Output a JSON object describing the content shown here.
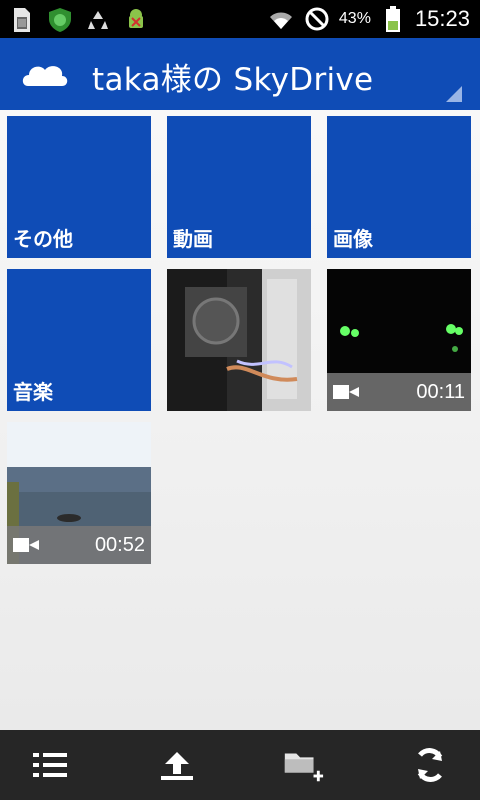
{
  "status_bar": {
    "battery_percent": "43%",
    "time": "15:23",
    "left_icons": [
      "sim-card-icon",
      "shield-lion-icon",
      "recycle-icon",
      "android-bug-icon"
    ],
    "right_icons": [
      "wifi-icon",
      "no-signal-icon",
      "battery-icon"
    ]
  },
  "app_bar": {
    "title": "taka様の SkyDrive",
    "icon": "cloud-icon",
    "accent": "#0f4cb6"
  },
  "tiles": [
    {
      "type": "folder",
      "label": "その他"
    },
    {
      "type": "folder",
      "label": "動画"
    },
    {
      "type": "folder",
      "label": "画像"
    },
    {
      "type": "folder",
      "label": "音楽"
    },
    {
      "type": "photo",
      "label": ""
    },
    {
      "type": "video",
      "duration": "00:11"
    },
    {
      "type": "video",
      "duration": "00:52"
    }
  ],
  "toolbar": {
    "buttons": [
      "list-icon",
      "upload-icon",
      "new-folder-icon",
      "refresh-icon"
    ]
  }
}
